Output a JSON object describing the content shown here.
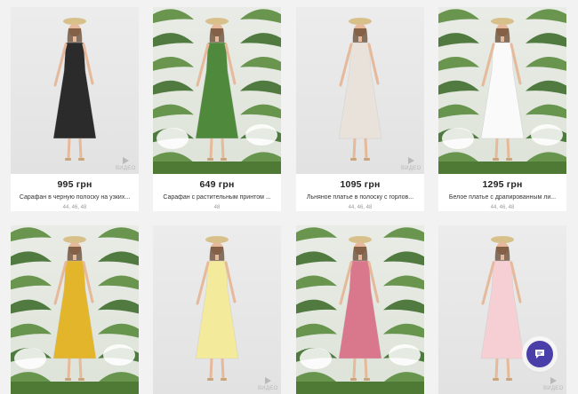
{
  "products": [
    {
      "price": "995 грн",
      "title": "Сарафан в черную полоску на узких...",
      "sizes": "44, 46, 48",
      "has_video": true,
      "video_label": "ВИДЕО",
      "dress_color": "#2b2b2b",
      "background": "studio"
    },
    {
      "price": "649 грн",
      "title": "Сарафан с растительным принтом ...",
      "sizes": "48",
      "has_video": false,
      "video_label": "",
      "dress_color": "#4f8a3c",
      "background": "jungle"
    },
    {
      "price": "1095 грн",
      "title": "Льняное платье в полоску с горлов...",
      "sizes": "44, 46, 48",
      "has_video": true,
      "video_label": "ВИДЕО",
      "dress_color": "#e8e2da",
      "background": "studio"
    },
    {
      "price": "1295 грн",
      "title": "Белое платье с драпированным ли...",
      "sizes": "44, 46, 48",
      "has_video": false,
      "video_label": "",
      "dress_color": "#fafafa",
      "background": "jungle"
    },
    {
      "price": "",
      "title": "",
      "sizes": "",
      "has_video": false,
      "video_label": "",
      "dress_color": "#e3b52a",
      "background": "jungle"
    },
    {
      "price": "",
      "title": "",
      "sizes": "",
      "has_video": true,
      "video_label": "ВИДЕО",
      "dress_color": "#f4ea9c",
      "background": "studio"
    },
    {
      "price": "",
      "title": "",
      "sizes": "",
      "has_video": false,
      "video_label": "",
      "dress_color": "#d9778d",
      "background": "jungle"
    },
    {
      "price": "",
      "title": "",
      "sizes": "",
      "has_video": true,
      "video_label": "ВИДЕО",
      "dress_color": "#f5cfd3",
      "background": "studio"
    }
  ],
  "chat": {
    "icon": "chat-bubble-icon",
    "color": "#4a3fa8"
  }
}
